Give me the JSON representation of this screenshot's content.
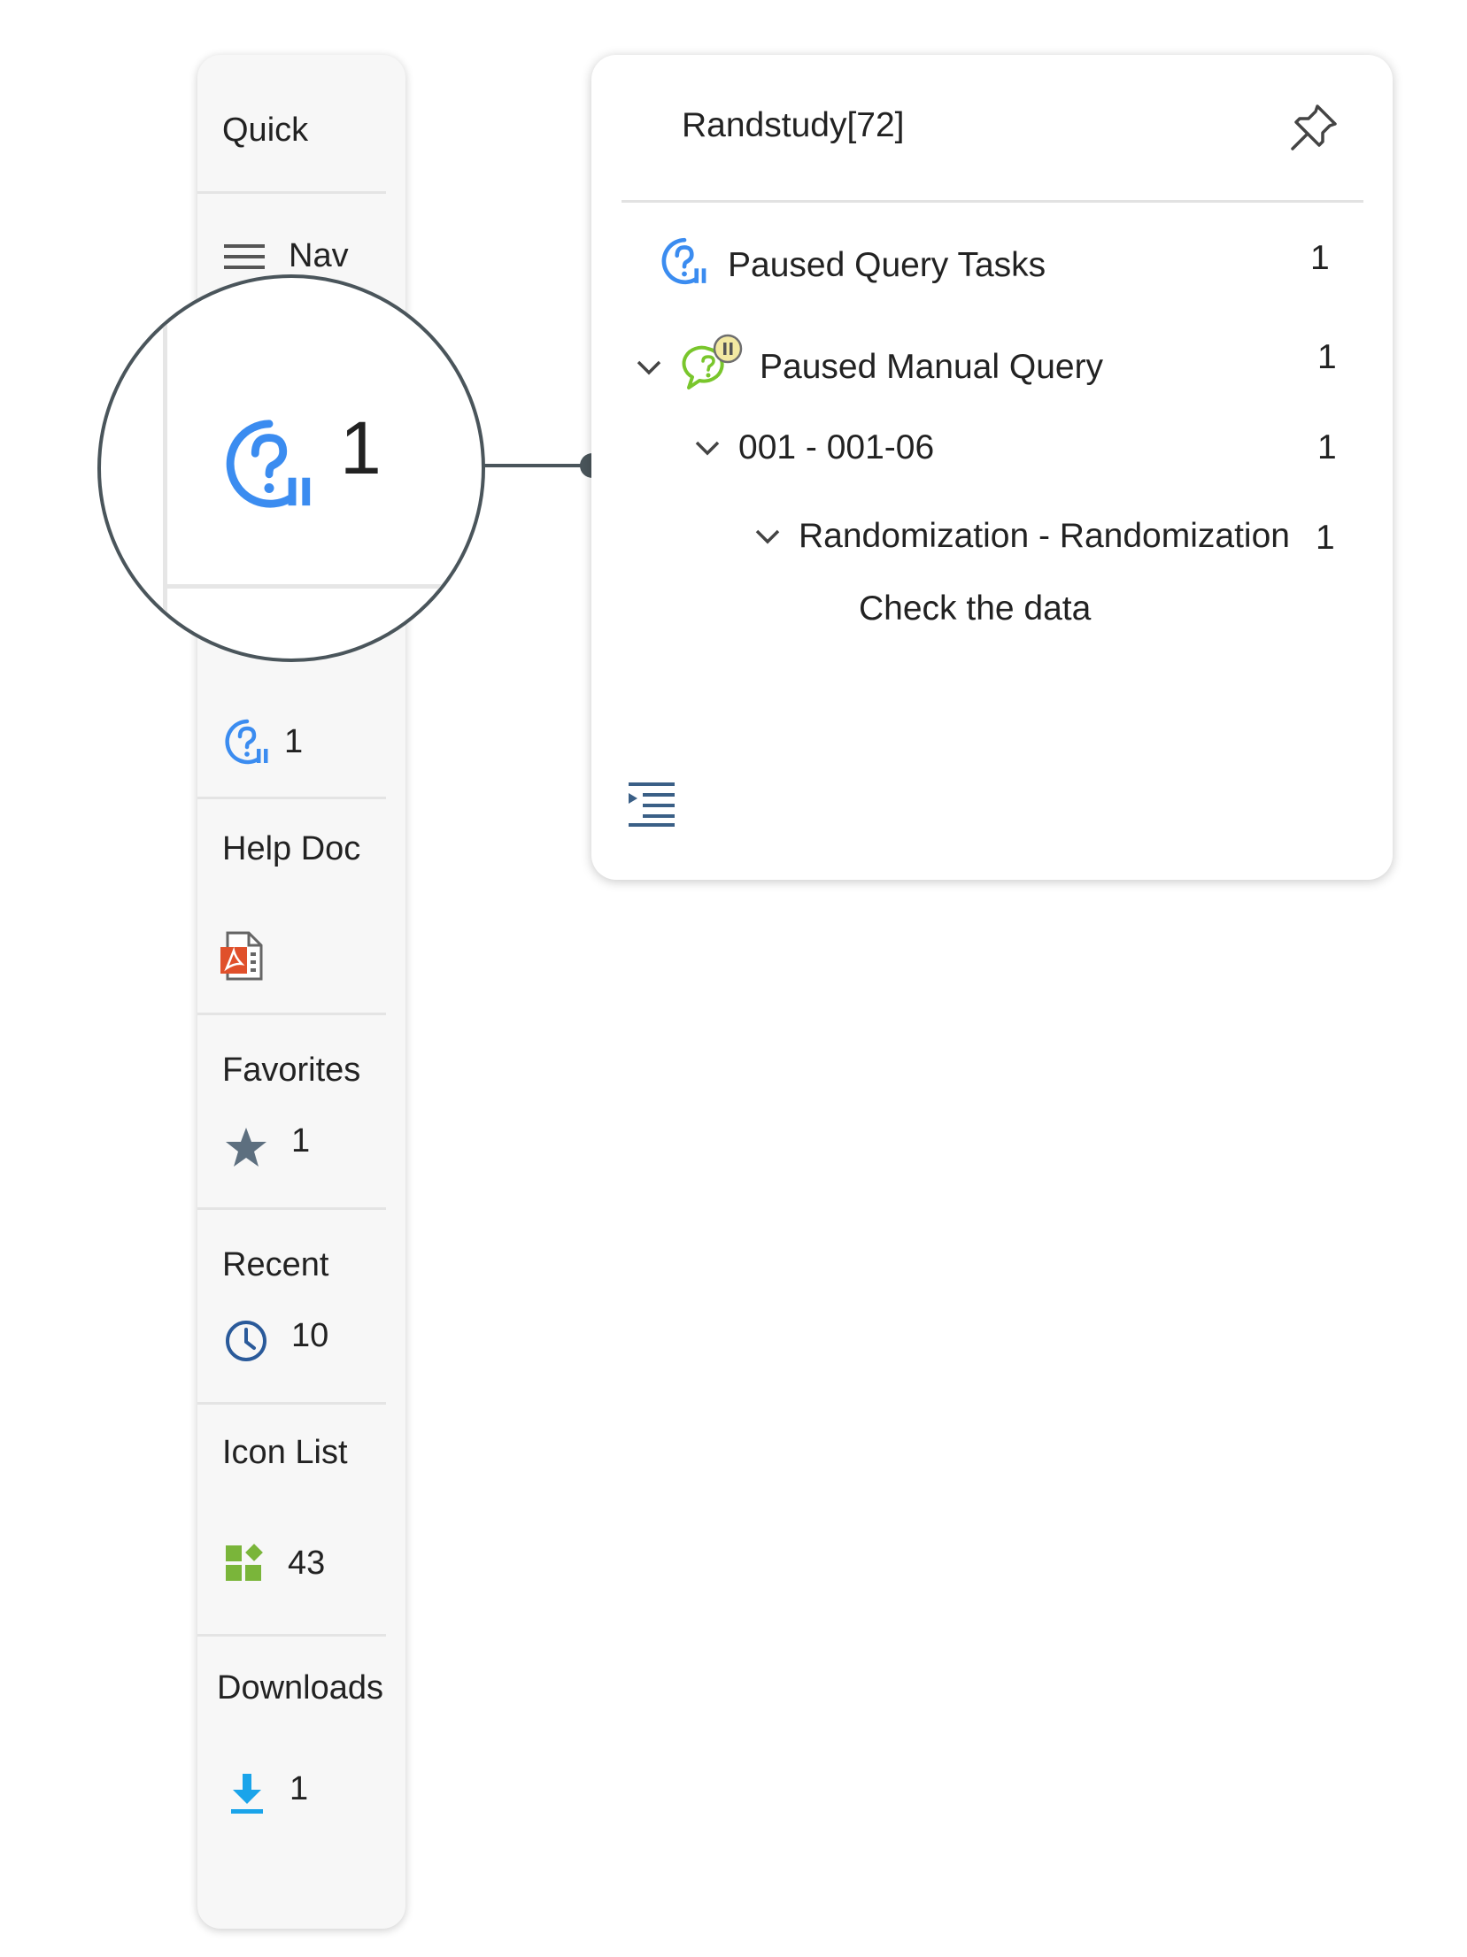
{
  "sidebar": {
    "quick_label": "Quick",
    "nav_label": "Nav",
    "tasks_count": "1",
    "help_doc_label": "Help Doc",
    "favorites_label": "Favorites",
    "favorites_count": "1",
    "recent_label": "Recent",
    "recent_count": "10",
    "icon_list_label": "Icon List",
    "icon_list_count": "43",
    "downloads_label": "Downloads",
    "downloads_count": "1"
  },
  "zoom": {
    "count": "1"
  },
  "panel": {
    "title": "Randstudy[72]",
    "tree": [
      {
        "label": "Paused Query Tasks",
        "count": "1",
        "icon": "paused-query-icon"
      },
      {
        "label": "Paused Manual Query",
        "count": "1",
        "icon": "paused-manual-query-icon",
        "expanded": true
      },
      {
        "label": "001 - 001-06",
        "count": "1",
        "expanded": true
      },
      {
        "label": "Randomization - Randomization",
        "count": "1",
        "expanded": true
      },
      {
        "label": "Check the data"
      }
    ]
  },
  "colors": {
    "query_blue": "#3b8cf0",
    "manual_query_green": "#79c62c",
    "pause_yellow": "#f3e9a2",
    "pdf_red": "#e0502b",
    "star_gray": "#5d6f7f",
    "clock_navy": "#2a5a9a",
    "grid_green": "#7ab53a",
    "download_blue": "#1aa4ea",
    "callout_gray": "#4a555b"
  }
}
